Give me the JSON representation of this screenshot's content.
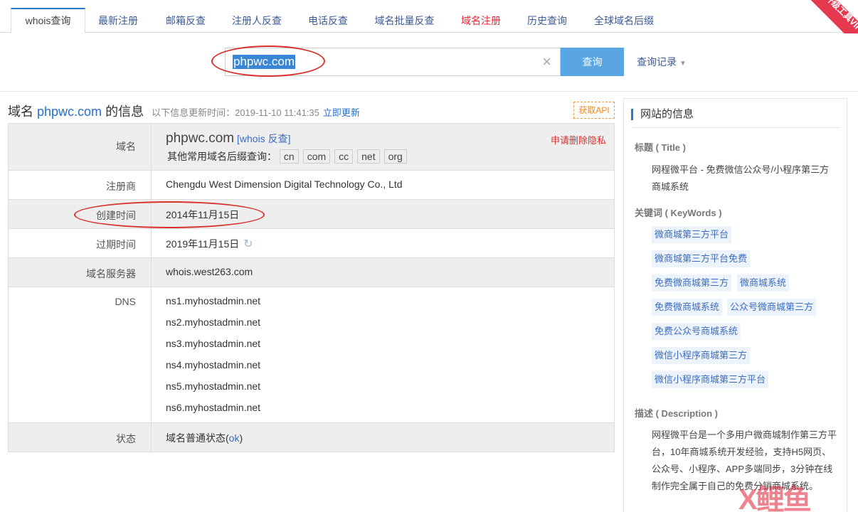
{
  "tabs": [
    {
      "label": "whois查询"
    },
    {
      "label": "最新注册"
    },
    {
      "label": "邮箱反查"
    },
    {
      "label": "注册人反查"
    },
    {
      "label": "电话反查"
    },
    {
      "label": "域名批量反查"
    },
    {
      "label": "域名注册"
    },
    {
      "label": "历史查询"
    },
    {
      "label": "全球域名后缀"
    }
  ],
  "vip_ribbon": "升级工具VIP",
  "search": {
    "value": "phpwc.com",
    "button": "查询",
    "history": "查询记录"
  },
  "heading": {
    "prefix": "域名",
    "domain": "phpwc.com",
    "suffix": "的信息",
    "update_time": "以下信息更新时间：2019-11-10 11:41:35",
    "update_link": "立即更新",
    "api": "获取API"
  },
  "table": {
    "domain_label": "域名",
    "domain_value": "phpwc.com",
    "whois_link": "[whois 反查]",
    "privacy": "申请删除隐私",
    "other_suffix_label": "其他常用域名后缀查询：",
    "tlds": [
      "cn",
      "com",
      "cc",
      "net",
      "org"
    ],
    "registrar_label": "注册商",
    "registrar": "Chengdu West Dimension Digital Technology Co., Ltd",
    "created_label": "创建时间",
    "created": "2014年11月15日",
    "expires_label": "过期时间",
    "expires": "2019年11月15日",
    "whois_server_label": "域名服务器",
    "whois_server": "whois.west263.com",
    "dns_label": "DNS",
    "dns": [
      "ns1.myhostadmin.net",
      "ns2.myhostadmin.net",
      "ns3.myhostadmin.net",
      "ns4.myhostadmin.net",
      "ns5.myhostadmin.net",
      "ns6.myhostadmin.net"
    ],
    "status_label": "状态",
    "status_prefix": "域名普通状态(",
    "status_link": "ok",
    "status_suffix": ")"
  },
  "sidebar": {
    "title": "网站的信息",
    "title_label": "标题 ( Title )",
    "title_text": "网程微平台 - 免费微信公众号/小程序第三方商城系统",
    "keywords_label": "关键词 ( KeyWords )",
    "keywords": [
      "微商城第三方平台",
      "微商城第三方平台免费",
      "免费微商城第三方",
      "微商城系统",
      "免费微商城系统",
      "公众号微商城第三方",
      "免费公众号商城系统",
      "微信小程序商城第三方",
      "微信小程序商城第三方平台"
    ],
    "description_label": "描述 ( Description )",
    "description": "网程微平台是一个多用户微商城制作第三方平台，10年商城系统开发经验，支持H5网页、公众号、小程序、APP多端同步，3分钟在线制作完全属于自己的免费分销商城系统。"
  },
  "watermark": "X鲤鱼",
  "colors": {
    "accent": "#2a7ad2",
    "link": "#3b6cc1",
    "red": "#d9322c",
    "button": "#5aa6e3"
  }
}
